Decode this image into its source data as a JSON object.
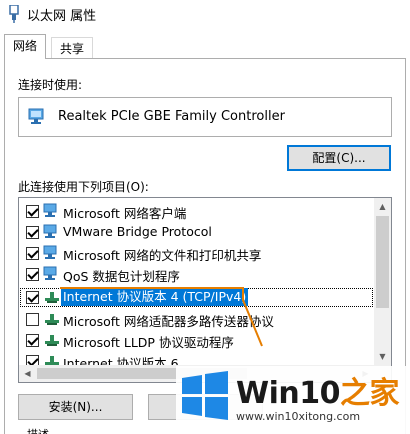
{
  "window": {
    "title": "以太网 属性"
  },
  "tabs": [
    {
      "label": "网络",
      "active": true
    },
    {
      "label": "共享",
      "active": false
    }
  ],
  "connect_using": {
    "label": "连接时使用:",
    "adapter": "Realtek PCIe GBE Family Controller",
    "configure_button": "配置(C)..."
  },
  "items_section": {
    "label": "此连接使用下列项目(O):",
    "items": [
      {
        "label": "Microsoft 网络客户端",
        "checked": true,
        "icon": "network-client-icon"
      },
      {
        "label": "VMware Bridge Protocol",
        "checked": true,
        "icon": "network-protocol-icon"
      },
      {
        "label": "Microsoft 网络的文件和打印机共享",
        "checked": true,
        "icon": "file-share-icon"
      },
      {
        "label": "QoS 数据包计划程序",
        "checked": true,
        "icon": "qos-icon"
      },
      {
        "label": "Internet 协议版本 4 (TCP/IPv4)",
        "checked": true,
        "icon": "protocol-icon",
        "selected": true
      },
      {
        "label": "Microsoft 网络适配器多路传送器协议",
        "checked": false,
        "icon": "protocol-icon"
      },
      {
        "label": "Microsoft LLDP 协议驱动程序",
        "checked": true,
        "icon": "protocol-icon"
      },
      {
        "label": "Internet 协议版本 6",
        "checked": true,
        "icon": "protocol-icon"
      }
    ]
  },
  "buttons": {
    "install": "安装(N)...",
    "uninstall": ""
  },
  "bottom_label": "描述",
  "watermark": {
    "title_main": "Win10",
    "title_accent": "之家",
    "url": "www.win10xitong.com"
  },
  "colors": {
    "selection": "#0078d7",
    "callout": "#e67e00",
    "win_logo": "#1e88e5"
  }
}
